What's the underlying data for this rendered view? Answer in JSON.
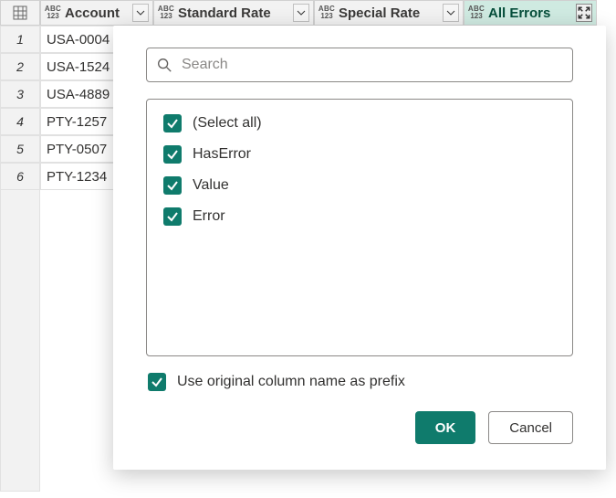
{
  "columns": [
    {
      "label": "Account",
      "type_top": "ABC",
      "type_bot": "123"
    },
    {
      "label": "Standard Rate",
      "type_top": "ABC",
      "type_bot": "123"
    },
    {
      "label": "Special Rate",
      "type_top": "ABC",
      "type_bot": "123"
    },
    {
      "label": "All Errors",
      "type_top": "ABC",
      "type_bot": "123",
      "active": true,
      "expand": true
    }
  ],
  "rows": [
    {
      "n": "1",
      "account": "USA-0004"
    },
    {
      "n": "2",
      "account": "USA-1524"
    },
    {
      "n": "3",
      "account": "USA-4889"
    },
    {
      "n": "4",
      "account": "PTY-1257"
    },
    {
      "n": "5",
      "account": "PTY-0507"
    },
    {
      "n": "6",
      "account": "PTY-1234"
    }
  ],
  "popup": {
    "search_placeholder": "Search",
    "options": [
      {
        "label": "(Select all)",
        "checked": true
      },
      {
        "label": "HasError",
        "checked": true
      },
      {
        "label": "Value",
        "checked": true
      },
      {
        "label": "Error",
        "checked": true
      }
    ],
    "prefix_label": "Use original column name as prefix",
    "prefix_checked": true,
    "ok_label": "OK",
    "cancel_label": "Cancel"
  }
}
